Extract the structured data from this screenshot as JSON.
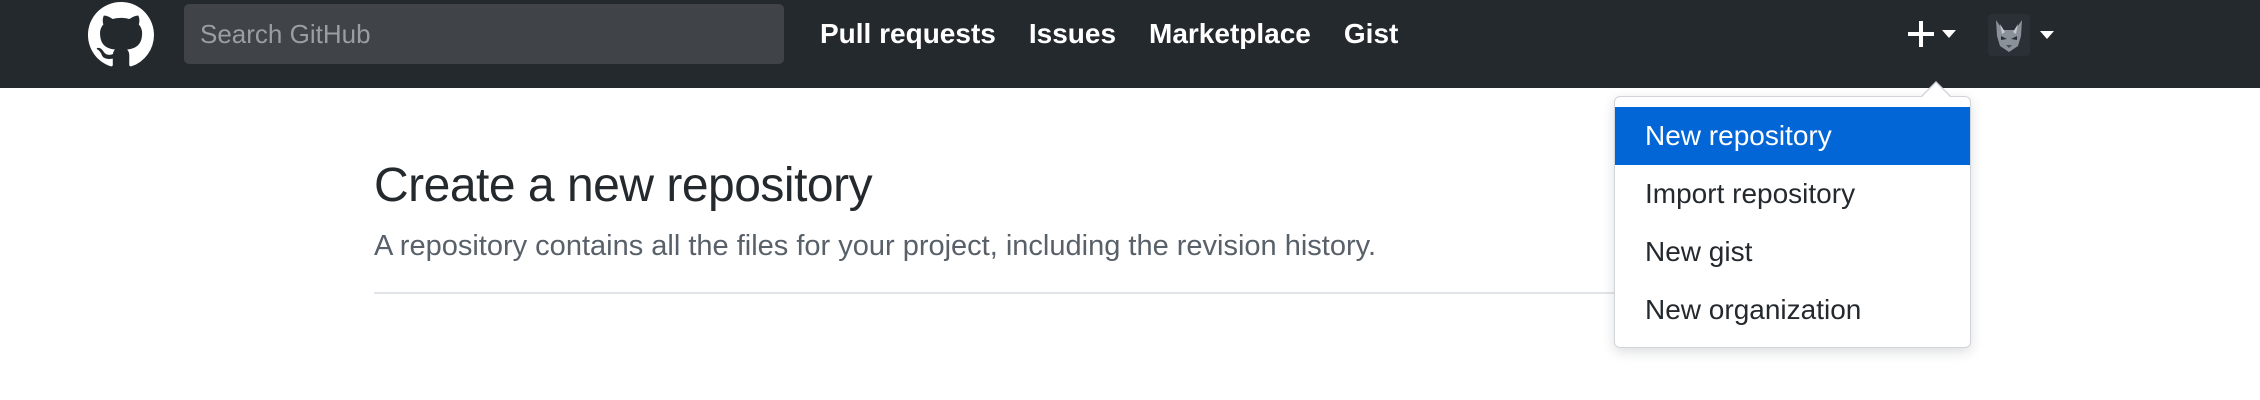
{
  "header": {
    "logo_icon": "github-octocat-icon",
    "search_placeholder": "Search GitHub",
    "nav": [
      {
        "label": "Pull requests"
      },
      {
        "label": "Issues"
      },
      {
        "label": "Marketplace"
      },
      {
        "label": "Gist"
      }
    ],
    "plus_icon": "plus-icon",
    "avatar_icon": "user-avatar"
  },
  "main": {
    "title": "Create a new repository",
    "subtitle": "A repository contains all the files for your project, including the revision history."
  },
  "dropdown": {
    "items": [
      {
        "label": "New repository",
        "active": true
      },
      {
        "label": "Import repository",
        "active": false
      },
      {
        "label": "New gist",
        "active": false
      },
      {
        "label": "New organization",
        "active": false
      }
    ]
  },
  "colors": {
    "header_bg": "#24292e",
    "accent": "#0366d6",
    "text": "#24292e",
    "muted_text": "#586069",
    "divider": "#e1e4e8"
  }
}
